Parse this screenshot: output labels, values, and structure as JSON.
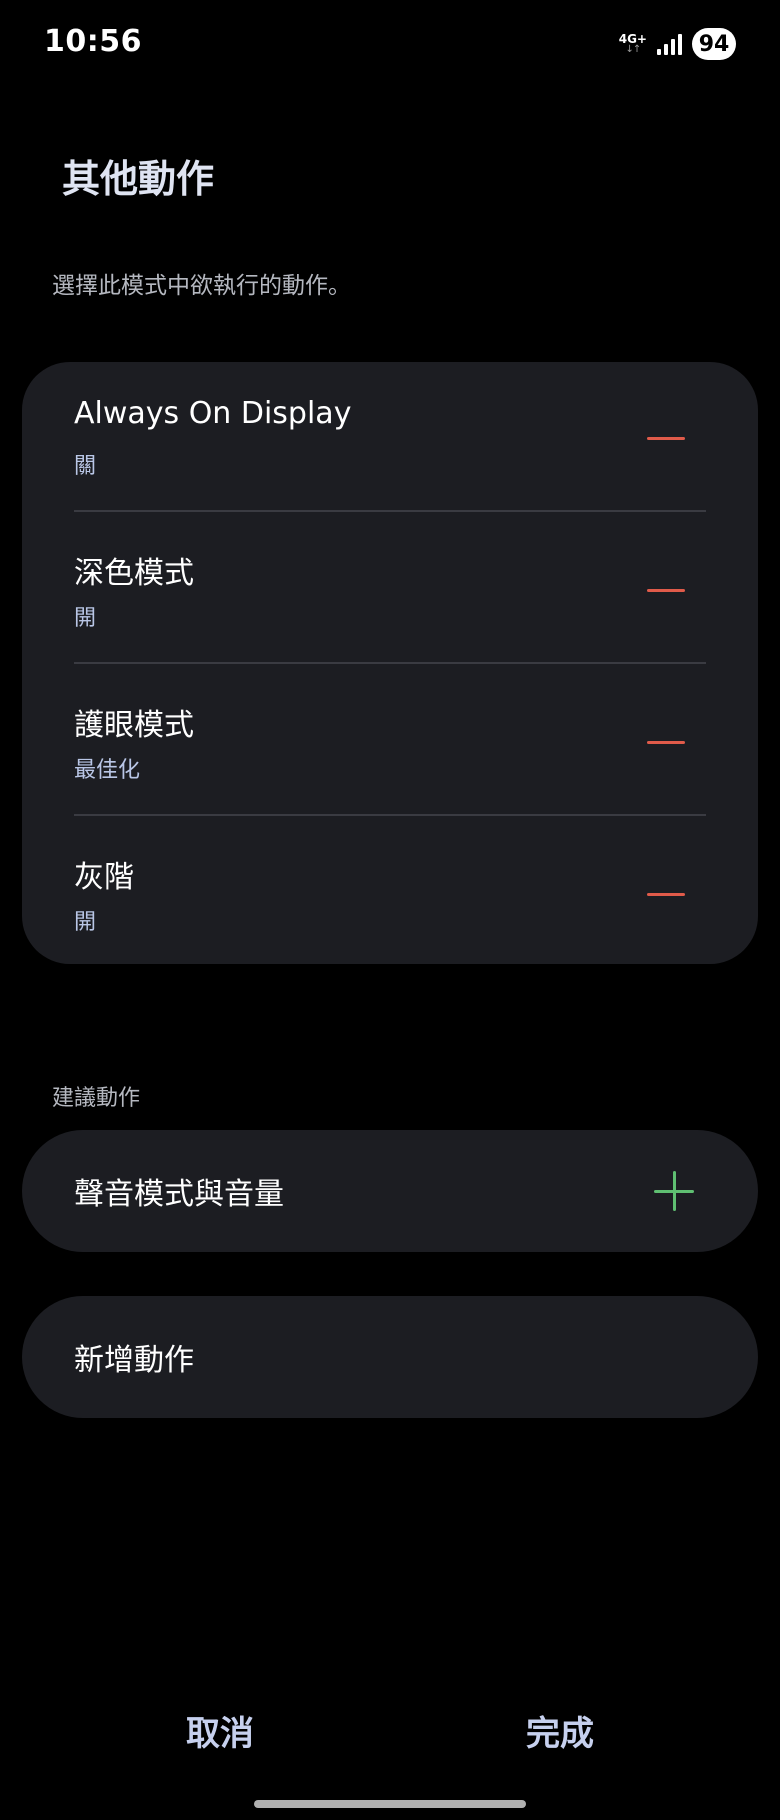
{
  "status_bar": {
    "time": "10:56",
    "network": "4G+",
    "network_arrows": "↓↑",
    "battery": "94"
  },
  "header": {
    "title": "其他動作",
    "subtitle": "選擇此模式中欲執行的動作。"
  },
  "actions": [
    {
      "title": "Always On Display",
      "value": "關"
    },
    {
      "title": "深色模式",
      "value": "開"
    },
    {
      "title": "護眼模式",
      "value": "最佳化"
    },
    {
      "title": "灰階",
      "value": "開"
    }
  ],
  "suggested": {
    "label": "建議動作",
    "item": "聲音模式與音量"
  },
  "add_action": "新增動作",
  "footer": {
    "cancel": "取消",
    "done": "完成"
  },
  "colors": {
    "background": "#000000",
    "card": "#1c1d22",
    "remove": "#e05b4a",
    "add": "#5fbf72",
    "accent_text": "#c6d0ee"
  }
}
